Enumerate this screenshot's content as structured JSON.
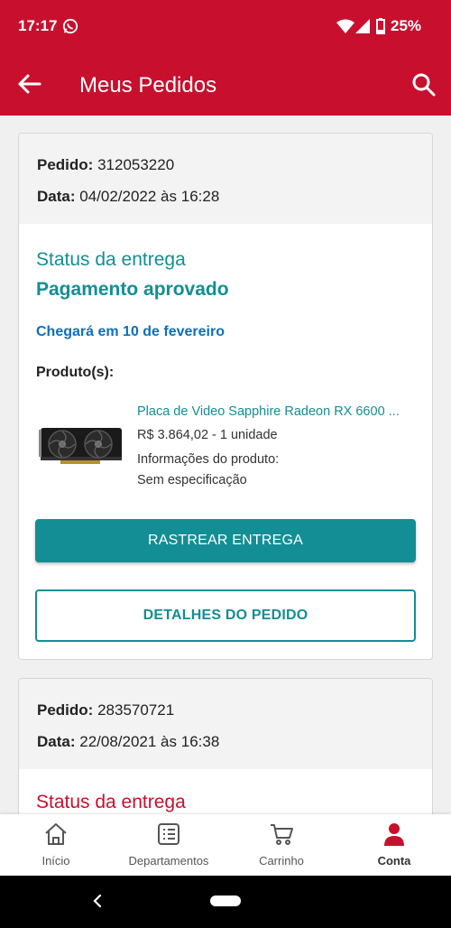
{
  "status_bar": {
    "time": "17:17",
    "battery": "25%"
  },
  "app_bar": {
    "title": "Meus Pedidos"
  },
  "orders": [
    {
      "order_label": "Pedido:",
      "order_number": "312053220",
      "date_label": "Data:",
      "date_value": "04/02/2022 às 16:28",
      "status_label": "Status da entrega",
      "status_value": "Pagamento aprovado",
      "arrival": "Chegará em 10 de fevereiro",
      "products_label": "Produto(s):",
      "product": {
        "name": "Placa de Video Sapphire Radeon RX 6600 ...",
        "price_qty": "R$ 3.864,02 - 1 unidade",
        "info_label": "Informações do produto:",
        "spec": "Sem especificação"
      },
      "track_button": "RASTREAR ENTREGA",
      "details_button": "DETALHES DO PEDIDO"
    },
    {
      "order_label": "Pedido:",
      "order_number": "283570721",
      "date_label": "Data:",
      "date_value": "22/08/2021 às 16:38",
      "status_label": "Status da entrega"
    }
  ],
  "bottom_nav": [
    {
      "label": "Início",
      "icon": "home-icon"
    },
    {
      "label": "Departamentos",
      "icon": "list-icon"
    },
    {
      "label": "Carrinho",
      "icon": "cart-icon"
    },
    {
      "label": "Conta",
      "icon": "user-icon",
      "active": true
    }
  ],
  "colors": {
    "brand_red": "#c8102e",
    "teal": "#138e94",
    "blue": "#0f6fb8"
  }
}
